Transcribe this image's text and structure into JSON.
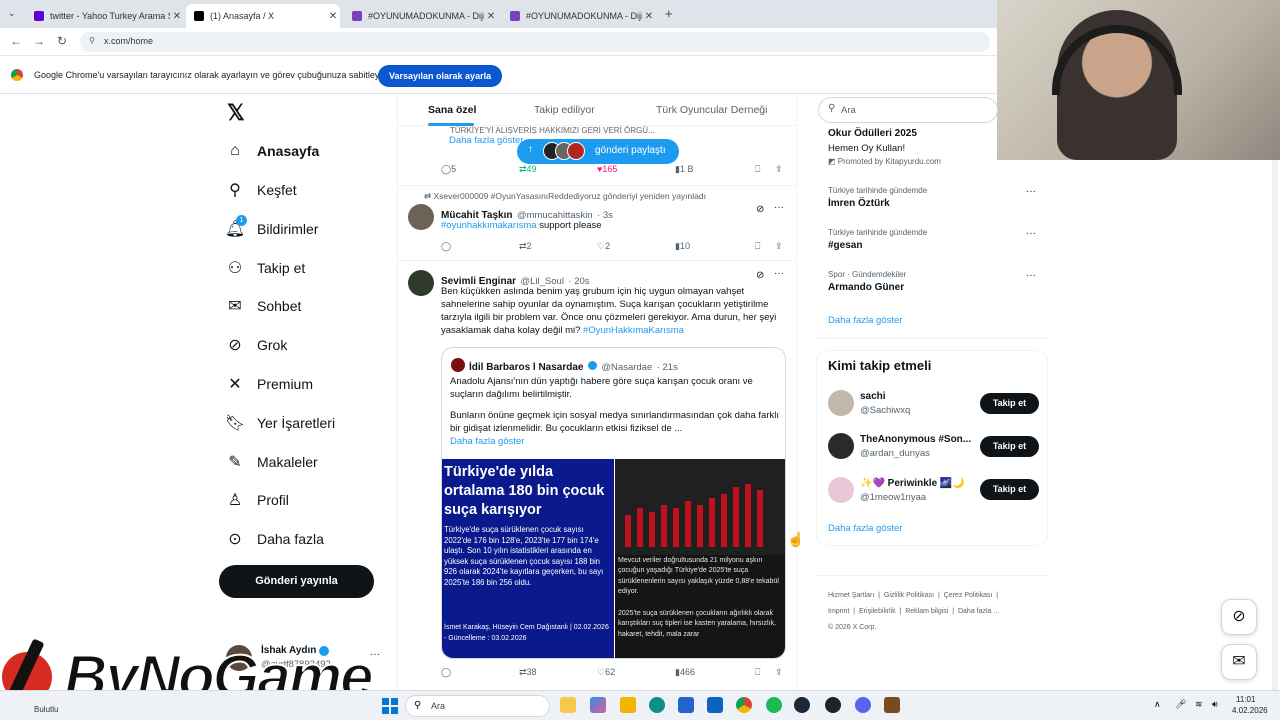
{
  "browser": {
    "tabs": [
      {
        "label": "twitter - Yahoo Turkey Arama S",
        "color": "#6001d2"
      },
      {
        "label": "(1) Anasayfa / X",
        "color": "#000000"
      },
      {
        "label": "#OYUNUMADOKUNMA - Dijit",
        "color": "#7b3fbf"
      },
      {
        "label": "#OYUNUMADOKUNMA - Dijit",
        "color": "#7b3fbf"
      }
    ],
    "url": "x.com/home",
    "infobar_message": "Google Chrome'u varsayılan tarayıcınız olarak ayarlayın ve görev çubuğunuza sabitleyin",
    "infobar_button": "Varsayılan olarak ayarla"
  },
  "sidebar": {
    "items": [
      {
        "label": "Anasayfa",
        "icon": "home-icon"
      },
      {
        "label": "Keşfet",
        "icon": "search-icon"
      },
      {
        "label": "Bildirimler",
        "icon": "bell-icon",
        "badge": "1"
      },
      {
        "label": "Takip et",
        "icon": "add-user-icon"
      },
      {
        "label": "Sohbet",
        "icon": "mail-icon"
      },
      {
        "label": "Grok",
        "icon": "grok-icon"
      },
      {
        "label": "Premium",
        "icon": "x-icon"
      },
      {
        "label": "Yer İşaretleri",
        "icon": "bookmark-icon"
      },
      {
        "label": "Makaleler",
        "icon": "article-icon"
      },
      {
        "label": "Profil",
        "icon": "profile-icon"
      },
      {
        "label": "Daha fazla",
        "icon": "more-icon"
      }
    ],
    "post_button": "Gönderi yayınla",
    "account_name": "İshak Aydın",
    "account_handle": "@aydf87893492",
    "more": "···"
  },
  "feed": {
    "tabs": [
      "Sana özel",
      "Takip ediliyor",
      "Türk Oyuncular Derneği"
    ],
    "top_snippet": "TÜRKİYE'Yİ ALIŞVERİŞ HAKKIMIZI GERİ VERİ ÖRGÜ...",
    "top_show_more": "Daha fazla göster",
    "share_pill": "gönderi paylaştı",
    "top_actions": {
      "reply": "5",
      "retweet": "49",
      "like": "165",
      "views": "1 B"
    },
    "retweet_header": "Xsever000009 #OyunYasasınıReddediyoruz gönderiyi yeniden yayınladı",
    "post1": {
      "name": "Mücahit Taşkın",
      "handle": "@mmucahittaskin",
      "time": "· 3s",
      "hashtag": "#oyunhakkımakarısma",
      "text": "support please",
      "retweets": "2",
      "likes": "2",
      "views": "10"
    },
    "post2": {
      "name": "Sevimli Enginar",
      "handle": "@Lil_Soul",
      "time": "· 20s",
      "text": "Ben küçükken aslında benim yaş grubum için hiç uygun olmayan vahşet sahnelerine sahip oyunlar da oynamıştım. Suça karışan çocukların yetiştirilme tarzıyla ilgili bir problem var. Önce onu çözmeleri gerekiyor. Ama durun, her şeyi yasaklamak daha kolay değil mi?",
      "hashtag": "#OyunHakkımaKarısma",
      "quote": {
        "name": "İdil Barbaros l Nasardae",
        "handle": "@Nasardae",
        "time": "· 21s",
        "text1": "Anadolu Ajansı'nın dün yaptığı habere göre suça karışan çocuk oranı ve suçların dağılımı belirtilmiştir.",
        "text2": "Bunların önüne geçmek için sosyal medya sınırlandırmasından çok daha farklı bir gidişat izlenmelidir. Bu çocukların etkisi fiziksel de ...",
        "show_more": "Daha fazla göster"
      },
      "image": {
        "headline": "Türkiye'de yılda ortalama 180 bin çocuk suça karışıyor",
        "body": "Türkiye'de suça sürüklenen çocuk sayısı 2022'de 176 bin 128'e, 2023'te 177 bin 174'e ulaştı. Son 10 yılın istatistikleri arasında en yüksek suça sürüklenen çocuk sayısı 188 bin 926 olarak 2024'te kayıtlara geçerken, bu sayı 2025'te 186 bin 256 oldu.",
        "byline": "İsmet Karakaş, Hüseyin Cem Dağıstanlı | 02.02.2026 - Güncelleme : 03.02.2026",
        "right_text1": "Mevcut veriler doğrultusunda 21 milyonu aşkın çocuğun yaşadığı Türkiye'de 2025'te suça sürüklenenlerin sayısı yaklaşık yüzde 0,88'e tekabül ediyor.",
        "right_text2": "2025'te suça sürüklenen çocukların ağırlıklı olarak karıştıkları suç tipleri ise kasten yaralama, hırsızlık, hakaret, tehdit, mala zarar",
        "bar_levels": [
          0.45,
          0.55,
          0.5,
          0.6,
          0.55,
          0.65,
          0.6,
          0.7,
          0.75,
          0.85,
          0.9,
          0.82
        ]
      },
      "retweets": "38",
      "likes": "62",
      "views": "466"
    }
  },
  "right": {
    "search_placeholder": "Ara",
    "ad_title": "Okur Ödülleri 2025",
    "ad_sub": "Hemen Oy Kullan!",
    "ad_promoted": "Promoted by Kitapyurdu.com",
    "trends": [
      {
        "context": "Türkiye tarihinde gündemde",
        "name": "İmren Öztürk"
      },
      {
        "context": "Türkiye tarihinde gündemde",
        "name": "#gesan"
      },
      {
        "context": "Spor · Gündemdekiler",
        "name": "Armando Güner"
      }
    ],
    "trends_more": "Daha fazla göster",
    "who_title": "Kimi takip etmeli",
    "who": [
      {
        "name": "sachi",
        "handle": "@Sachiwxq",
        "button": "Takip et"
      },
      {
        "name": "TheAnonymous #Son...",
        "handle": "@ardan_dunyas",
        "button": "Takip et"
      },
      {
        "name": "✨💜 Periwinkle 🌌🌙",
        "handle": "@1meow1nyaa",
        "button": "Takip et"
      }
    ],
    "who_more": "Daha fazla göster",
    "footer": [
      "Hizmet Şartları",
      "Gizlilik Politikası",
      "Çerez Politikası",
      "Imprint",
      "Erişilebilirlik",
      "Reklam bilgisi",
      "Daha fazla ...",
      "© 2026 X Corp."
    ]
  },
  "watermark": "ByNoGame",
  "taskbar": {
    "weather": "Bulutlu",
    "search": "Ara",
    "time": "11:01",
    "date": "4.02.2026"
  }
}
